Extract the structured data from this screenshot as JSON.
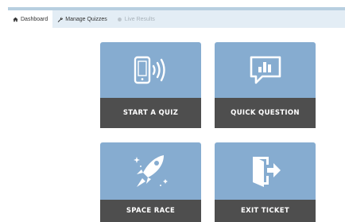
{
  "nav": {
    "tabs": [
      {
        "label": "Dashboard",
        "icon": "home-icon",
        "active": true
      },
      {
        "label": "Manage Quizzes",
        "icon": "wrench-icon",
        "active": false
      },
      {
        "label": "Live Results",
        "icon": "circle-icon",
        "disabled": true
      }
    ]
  },
  "tiles": [
    {
      "label": "START A QUIZ",
      "icon": "phone-broadcast-icon"
    },
    {
      "label": "QUICK QUESTION",
      "icon": "chat-chart-icon"
    },
    {
      "label": "SPACE RACE",
      "icon": "rocket-icon"
    },
    {
      "label": "EXIT TICKET",
      "icon": "exit-door-icon"
    }
  ],
  "colors": {
    "tile_bg": "#86acd0",
    "label_bg": "#4e4e4e",
    "nav_bg": "#e3edf5"
  }
}
